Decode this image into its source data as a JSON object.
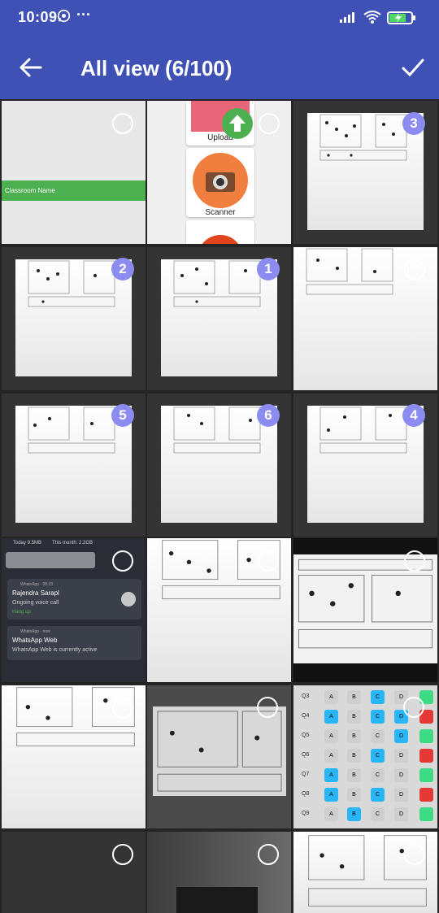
{
  "status": {
    "time": "10:09",
    "dots": "···"
  },
  "appbar": {
    "title": "All view (6/100)"
  },
  "tiles": {
    "classroom_label": "Classroom Name",
    "upload_label": "Upload",
    "scanner_label": "Scanner",
    "notif_today": "Today 9.5MB",
    "notif_month": "This month: 2.2GB",
    "notif_app1": "WhatsApp · 08:23",
    "notif_caller": "Rajendra Sarapl",
    "notif_call": "Ongoing voice call",
    "notif_hangup": "Hang up",
    "notif_app2": "WhatsApp · now",
    "notif_web": "WhatsApp Web",
    "notif_web_msg": "WhatsApp Web is currently active",
    "selection_numbers": {
      "t3": "3",
      "t4": "2",
      "t5": "1",
      "t7": "5",
      "t8": "6",
      "t9": "4"
    },
    "answer_questions": [
      "Q3",
      "Q4",
      "Q5",
      "Q6",
      "Q7",
      "Q8",
      "Q9"
    ],
    "answer_choices": [
      "A",
      "B",
      "C",
      "D"
    ]
  },
  "colors": {
    "appbar": "#3f51b5",
    "badge": "#8c8cf0",
    "green_bar": "#4caf50"
  }
}
